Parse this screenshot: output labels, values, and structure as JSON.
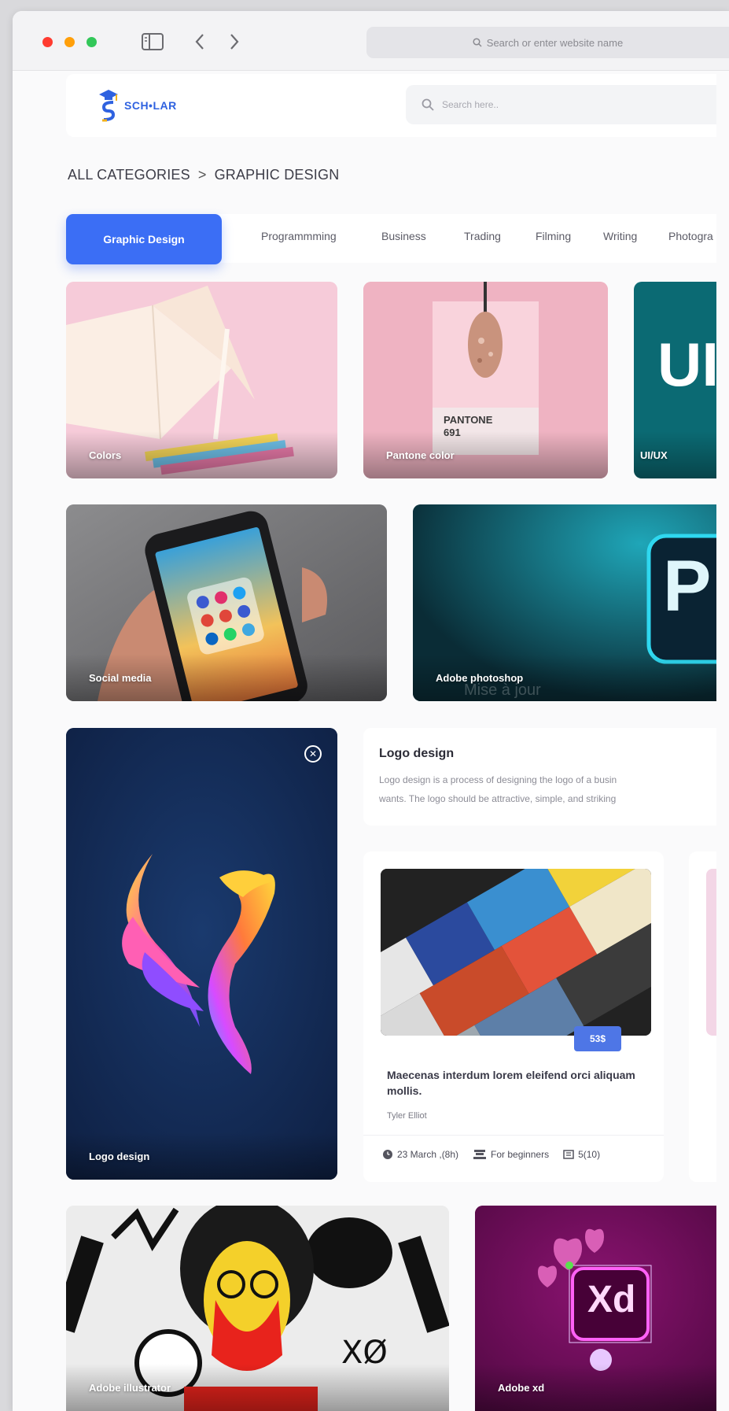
{
  "browser": {
    "url_placeholder": "Search or enter website name"
  },
  "header": {
    "logo_text": "SCH•LAR",
    "search_placeholder": "Search here.."
  },
  "breadcrumb": {
    "root": "ALL CATEGORIES",
    "separator": ">",
    "current": "GRAPHIC DESIGN"
  },
  "tabs": {
    "active": "Graphic Design",
    "items": [
      "Programmming",
      "Business",
      "Trading",
      "Filming",
      "Writing",
      "Photogra"
    ]
  },
  "cards": {
    "colors": "Colors",
    "pantone": "Pantone color",
    "pantone_swatch": "PANTONE\n691",
    "uiux": "UI/UX",
    "uiux_big": "UI",
    "social": "Social media",
    "photoshop": "Adobe photoshop",
    "photoshop_big": "P",
    "logo": "Logo design",
    "illustrator": "Adobe illustrator",
    "xd": "Adobe xd",
    "xd_big": "Xd"
  },
  "overlay_text": "Mise à jour",
  "info": {
    "title": "Logo design",
    "description_line1": "Logo design is a process of designing the logo of a busin",
    "description_line2": "wants. The logo should be attractive, simple, and striking"
  },
  "course": {
    "price": "53$",
    "title": "Maecenas interdum lorem eleifend orci aliquam mollis.",
    "author": "Tyler Elliot",
    "date": "23 March ,(8h)",
    "level": "For beginners",
    "lessons": "5(10)"
  },
  "colors": {
    "accent": "#3b6ef5",
    "price_badge": "#4e76e6"
  }
}
